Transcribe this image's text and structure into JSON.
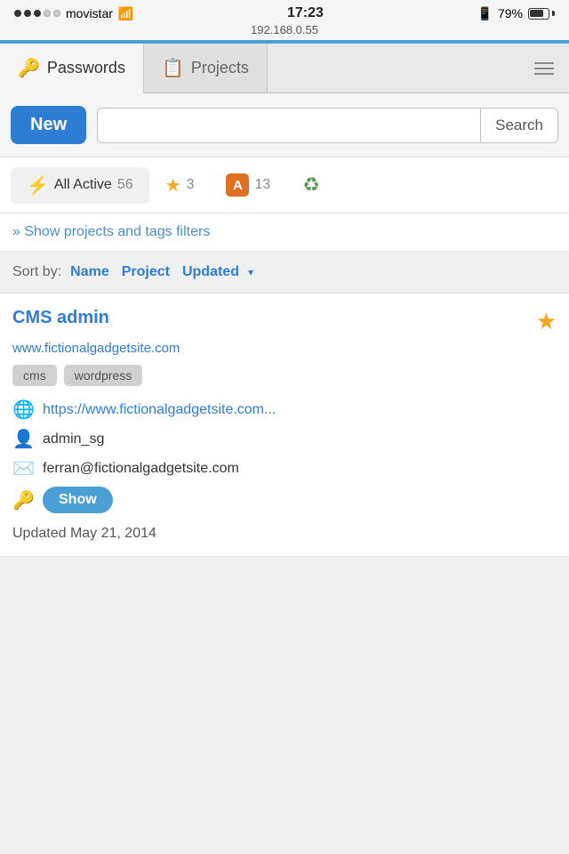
{
  "status_bar": {
    "carrier": "movistar",
    "time": "17:23",
    "ip": "192.168.0.55",
    "battery": "79%",
    "bluetooth": "BT"
  },
  "tabs": {
    "passwords_label": "Passwords",
    "projects_label": "Projects",
    "passwords_icon": "🔑",
    "projects_icon": "📋"
  },
  "toolbar": {
    "new_label": "New",
    "search_label": "Search",
    "search_placeholder": ""
  },
  "filters": {
    "all_active_label": "All Active",
    "all_active_count": "56",
    "starred_count": "3",
    "letter_label": "A",
    "letter_count": "13"
  },
  "show_filters_label": "» Show projects and tags filters",
  "sort": {
    "label": "Sort by:",
    "name": "Name",
    "project": "Project",
    "updated": "Updated"
  },
  "entry": {
    "title": "CMS admin",
    "url": "www.fictionalgadgetsite.com",
    "tags": [
      "cms",
      "wordpress"
    ],
    "link": "https://www.fictionalgadgetsite.com...",
    "username": "admin_sg",
    "email": "ferran@fictionalgadgetsite.com",
    "show_label": "Show",
    "updated": "Updated May 21, 2014"
  }
}
